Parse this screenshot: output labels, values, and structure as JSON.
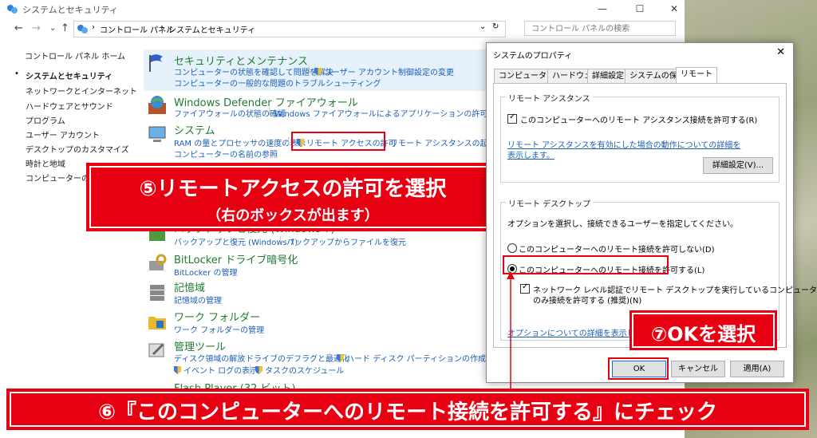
{
  "window": {
    "title": "システムとセキュリティ",
    "minimize": "—",
    "maximize": "☐",
    "close": "✕"
  },
  "address": {
    "back": "←",
    "forward": "→",
    "recent": "⌄",
    "up": "↑",
    "sep": "›",
    "crumb1": "コントロール パネル",
    "crumb2": "システムとセキュリティ",
    "dropdown": "⌄",
    "refresh": "↻",
    "search_placeholder": "コントロール パネルの検索"
  },
  "sidebar": {
    "home": "コントロール パネル ホーム",
    "items": [
      "システムとセキュリティ",
      "ネットワークとインターネット",
      "ハードウェアとサウンド",
      "プログラム",
      "ユーザー アカウント",
      "デスクトップのカスタマイズ",
      "時計と地域",
      "コンピューターの簡単操作"
    ]
  },
  "categories": {
    "security": {
      "title": "セキュリティとメンテナンス",
      "link1": "コンピューターの状態を確認して問題を解決",
      "link2": "ユーザー アカウント制御設定の変更",
      "link3": "コンピューターの一般的な問題のトラブルシューティング"
    },
    "firewall": {
      "title": "Windows Defender ファイアウォール",
      "link1": "ファイアウォールの状態の確認",
      "link2": "Windows ファイアウォールによるアプリケーションの許可"
    },
    "system": {
      "title": "システム",
      "link1": "RAM の量とプロセッサの速度の表示",
      "link2": "リモート アクセスの許可",
      "link3": "リモート アシスタンスの起動",
      "link4": "コンピューターの名前の参照"
    },
    "backup": {
      "title": "バックアップと復元 (Windows 7)",
      "link1": "バックアップと復元 (Windows 7)",
      "link2": "バックアップからファイルを復元"
    },
    "bitlocker": {
      "title": "BitLocker ドライブ暗号化",
      "link1": "BitLocker の管理"
    },
    "storage": {
      "title": "記憶域",
      "link1": "記憶域の管理"
    },
    "workfolders": {
      "title": "ワーク フォルダー",
      "link1": "ワーク フォルダーの管理"
    },
    "admintools": {
      "title": "管理ツール",
      "link1": "ディスク領域の解放",
      "link2": "ドライブのデフラグと最適化",
      "link3": "ハード ディスク パーティションの作成とフォーマット",
      "link4": "イベント ログの表示",
      "link5": "タスクのスケジュール"
    },
    "flash": {
      "title": "Flash Player (32 ビット)"
    }
  },
  "dialog": {
    "title": "システムのプロパティ",
    "close": "✕",
    "tabs": [
      "コンピューター名",
      "ハードウェア",
      "詳細設定",
      "システムの保護",
      "リモート"
    ],
    "assist_group": "リモート アシスタンス",
    "assist_check": "このコンピューターへのリモート アシスタンス接続を許可する(R)",
    "assist_link1": "リモート アシスタンスを有効にした場合の動作についての詳細を",
    "assist_link2": "表示します。",
    "advanced_button": "詳細設定(V)...",
    "desktop_group": "リモート デスクトップ",
    "desktop_desc": "オプションを選択し、接続できるユーザーを指定してください。",
    "radio_deny": "このコンピューターへのリモート接続を許可しない(D)",
    "radio_allow": "このコンピューターへのリモート接続を許可する(L)",
    "nla_check1": "ネットワーク レベル認証でリモート デスクトップを実行しているコンピューターから",
    "nla_check2": "のみ接続を許可する (推奨)(N)",
    "options_link": "オプションについての詳細を表示します。",
    "ok": "OK",
    "cancel": "キャンセル",
    "apply": "適用(A)"
  },
  "annotations": {
    "step5_line1": "⑤リモートアクセスの許可を選択",
    "step5_line2": "（右のボックスが出ます）",
    "step7": "⑦OKを選択",
    "step6": "⑥『このコンピューターへのリモート接続を許可する』にチェック"
  },
  "colors": {
    "annotation_red": "#e60012",
    "link_blue": "#1b5fb5",
    "category_green": "#1e7b2e"
  }
}
